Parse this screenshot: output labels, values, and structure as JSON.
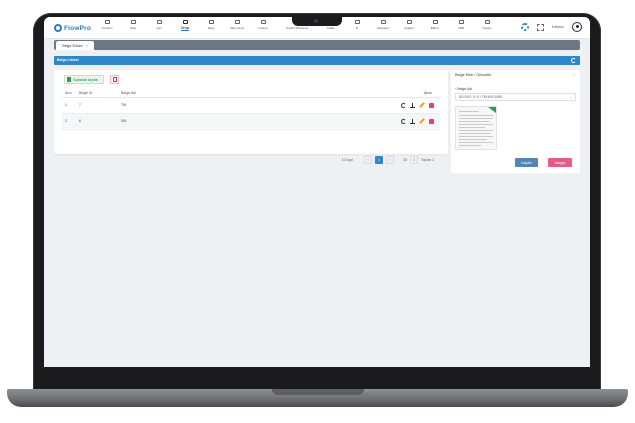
{
  "app": {
    "logo_text": "FlowPro",
    "user_name": "Kullanıcı"
  },
  "nav": {
    "items": [
      {
        "label": "Yönetim",
        "active": false
      },
      {
        "label": "Stok",
        "active": false
      },
      {
        "label": "Cari",
        "active": false
      },
      {
        "label": "Belge",
        "active": true
      },
      {
        "label": "Satış",
        "active": false
      },
      {
        "label": "Satın Alma",
        "active": false
      },
      {
        "label": "Finans",
        "active": false
      },
      {
        "label": "Üretim Planlama",
        "active": false
      },
      {
        "label": "Kalite",
        "active": false
      },
      {
        "label": "İK",
        "active": false
      },
      {
        "label": "Raporlar",
        "active": false
      },
      {
        "label": "Ayarlar",
        "active": false
      },
      {
        "label": "Bakım",
        "active": false
      },
      {
        "label": "CRM",
        "active": false
      },
      {
        "label": "Yardım",
        "active": false
      }
    ]
  },
  "tabs": [
    {
      "label": "Belge Sürüm"
    }
  ],
  "section": {
    "title": "Belge Listesi"
  },
  "toolbar": {
    "excel_label": "Sayfadaki kayıtlar"
  },
  "table": {
    "headers": {
      "sira": "Sıra",
      "belge_id": "Belge ID",
      "belge_adi": "Belge Adı",
      "islem": "İşlem"
    },
    "rows": [
      {
        "sira": "1",
        "belge_id": "7",
        "belge_adi": "TM"
      },
      {
        "sira": "2",
        "belge_id": "6",
        "belge_adi": "SM"
      }
    ]
  },
  "pager": {
    "page_size_label": "10 kayıt",
    "pages": [
      "‹",
      "1",
      "›"
    ],
    "active_page": "1",
    "goto_label": "Git",
    "total_label": "Toplam 2"
  },
  "side_panel": {
    "title": "Belge Ekle / Güncelle",
    "close": "×",
    "field_label": "Belge Adı",
    "field_required": "*",
    "field_value": "SÜ 000 / 0 / 0 / TM 505 /0000",
    "save_label": "Kaydet",
    "cancel_label": "Vazgeç"
  },
  "colors": {
    "accent": "#2e86c6",
    "save": "#4f86b8",
    "cancel": "#e65a8a",
    "delete": "#e0407a",
    "edit": "#f1a21c"
  }
}
